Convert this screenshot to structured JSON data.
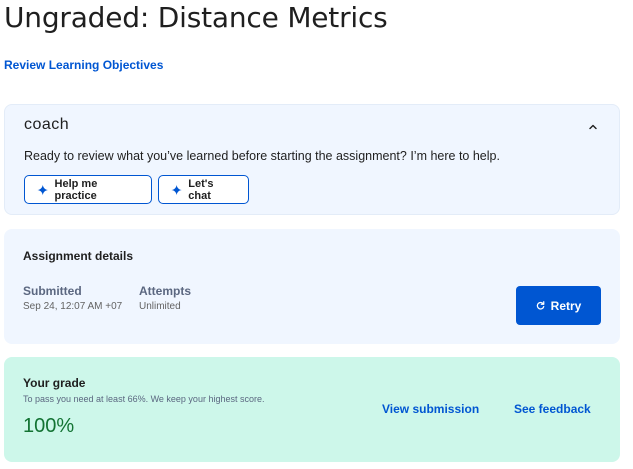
{
  "page": {
    "title": "Ungraded: Distance Metrics",
    "objectives_link": "Review Learning Objectives"
  },
  "coach": {
    "logo": "coach",
    "message": "Ready to review what you’ve learned before starting the assignment? I’m here to help.",
    "buttons": {
      "practice": "Help me practice",
      "chat": "Let's chat"
    }
  },
  "assignment": {
    "title": "Assignment details",
    "submitted_label": "Submitted",
    "submitted_value": "Sep 24, 12:07 AM +07",
    "attempts_label": "Attempts",
    "attempts_value": "Unlimited",
    "retry_label": "Retry"
  },
  "grade": {
    "title": "Your grade",
    "subtitle": "To pass you need at least 66%. We keep your highest score.",
    "value": "100%",
    "view_submission": "View submission",
    "see_feedback": "See feedback"
  },
  "colors": {
    "accent": "#0056d2",
    "grade_green": "#137333",
    "card_blue": "#f0f6ff",
    "card_green": "#cdf7ea"
  }
}
